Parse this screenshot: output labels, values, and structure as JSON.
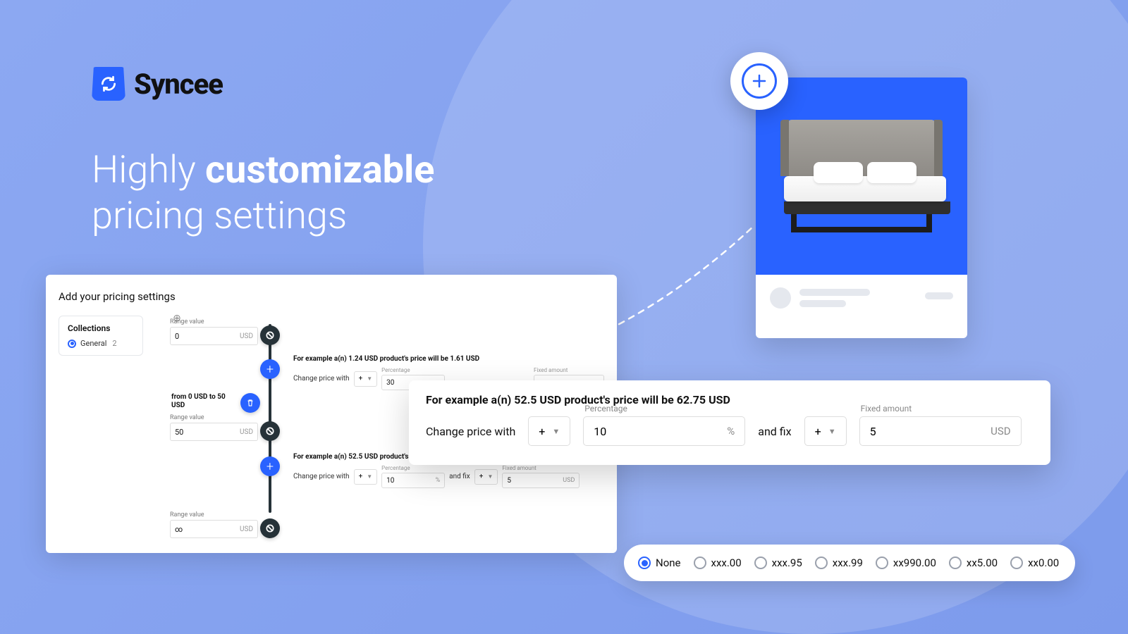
{
  "brand": {
    "name": "Syncee"
  },
  "headline": {
    "pre": "Highly ",
    "strong": "customizable",
    "post": "pricing settings"
  },
  "panel": {
    "title": "Add your pricing settings",
    "sidebar": {
      "title": "Collections",
      "item_label": "General",
      "item_count": "2"
    },
    "range_label": "Range value",
    "currency": "USD",
    "range0_value": "0",
    "range1_value": "50",
    "range2_value": "∞",
    "hint_label": "from 0 USD to 50 USD",
    "rule1": {
      "example": "For example a(n) 1.24 USD product's price will be 1.61 USD",
      "change_label": "Change price with",
      "op": "+",
      "pct_label": "Percentage",
      "pct_value": "30",
      "fix_label": "Fixed amount"
    },
    "rule2": {
      "example": "For example a(n) 52.5 USD product's price will be 62.75 USD",
      "change_label": "Change price with",
      "op": "+",
      "pct_label": "Percentage",
      "pct_value": "10",
      "pct_suffix": "%",
      "and_fix": "and fix",
      "fix_op": "+",
      "fix_label": "Fixed amount",
      "fix_value": "5",
      "fix_suffix": "USD"
    }
  },
  "popout": {
    "example": "For example a(n) 52.5 USD product's price will be 62.75 USD",
    "change_label": "Change price with",
    "op": "+",
    "pct_label": "Percentage",
    "pct_value": "10",
    "pct_suffix": "%",
    "and_fix": "and fix",
    "fix_op": "+",
    "fix_label": "Fixed amount",
    "fix_value": "5",
    "fix_suffix": "USD"
  },
  "rounding": {
    "options": [
      "None",
      "xxx.00",
      "xxx.95",
      "xxx.99",
      "xx990.00",
      "xx5.00",
      "xx0.00"
    ],
    "selected": 0
  }
}
